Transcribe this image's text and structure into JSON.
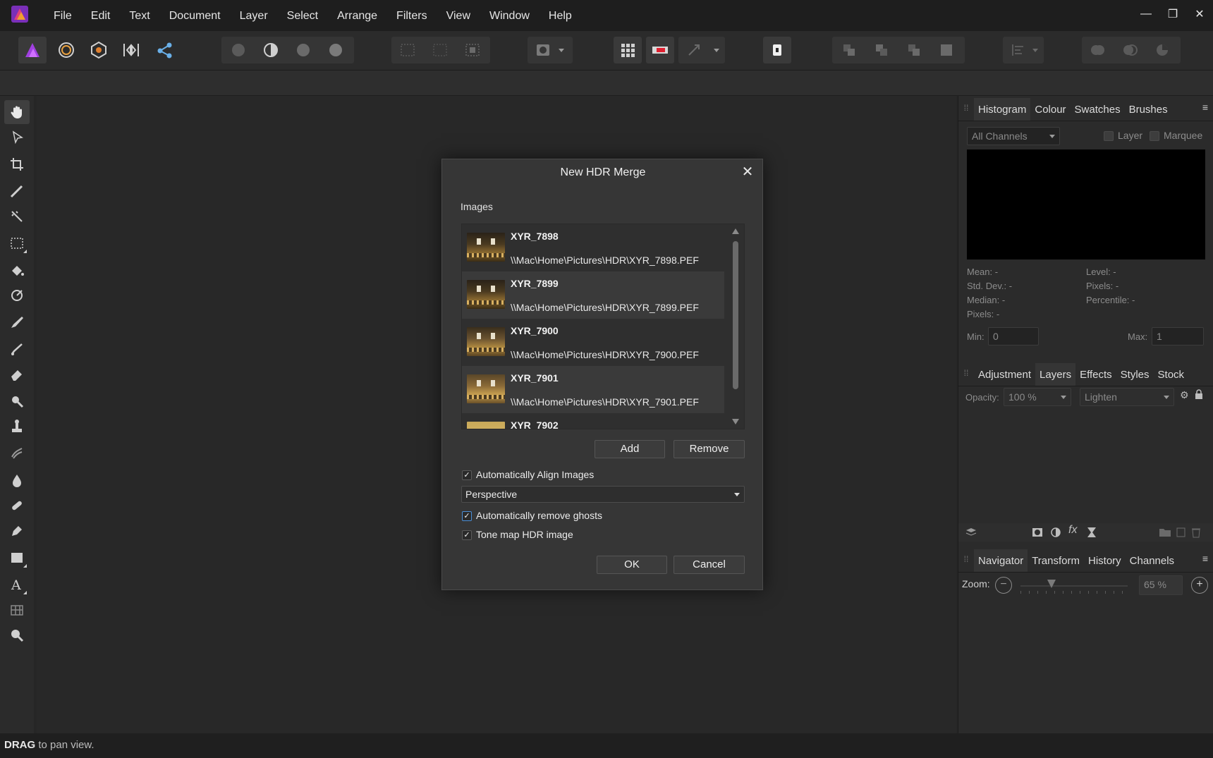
{
  "menu": [
    "File",
    "Edit",
    "Text",
    "Document",
    "Layer",
    "Select",
    "Arrange",
    "Filters",
    "View",
    "Window",
    "Help"
  ],
  "window_controls": {
    "minimize": "—",
    "restore": "❐",
    "close": "✕"
  },
  "status": {
    "bold": "DRAG",
    "rest": " to pan view."
  },
  "dialog": {
    "title": "New HDR Merge",
    "close": "✕",
    "images_label": "Images",
    "images": [
      {
        "name": "XYR_7898",
        "path": "\\\\Mac\\Home\\Pictures\\HDR\\XYR_7898.PEF"
      },
      {
        "name": "XYR_7899",
        "path": "\\\\Mac\\Home\\Pictures\\HDR\\XYR_7899.PEF"
      },
      {
        "name": "XYR_7900",
        "path": "\\\\Mac\\Home\\Pictures\\HDR\\XYR_7900.PEF"
      },
      {
        "name": "XYR_7901",
        "path": "\\\\Mac\\Home\\Pictures\\HDR\\XYR_7901.PEF"
      },
      {
        "name": "XYR_7902",
        "path": ""
      }
    ],
    "add_label": "Add",
    "remove_label": "Remove",
    "align_label": "Automatically Align Images",
    "align_checked": true,
    "align_mode": "Perspective",
    "ghosts_label": "Automatically remove ghosts",
    "ghosts_checked": true,
    "tonemap_label": "Tone map HDR image",
    "tonemap_checked": true,
    "ok_label": "OK",
    "cancel_label": "Cancel"
  },
  "histogram_panel": {
    "tabs": [
      "Histogram",
      "Colour",
      "Swatches",
      "Brushes"
    ],
    "channel": "All Channels",
    "layer_label": "Layer",
    "marquee_label": "Marquee",
    "stats_left": [
      "Mean: -",
      "Std. Dev.: -",
      "Median: -",
      "Pixels: -"
    ],
    "stats_right": [
      "Level: -",
      "Pixels: -",
      "Percentile: -"
    ],
    "min_label": "Min:",
    "min_value": "0",
    "max_label": "Max:",
    "max_value": "1"
  },
  "layers_panel": {
    "tabs": [
      "Adjustment",
      "Layers",
      "Effects",
      "Styles",
      "Stock"
    ],
    "opacity_label": "Opacity:",
    "opacity_value": "100 %",
    "blend_mode": "Lighten"
  },
  "navigator_panel": {
    "tabs": [
      "Navigator",
      "Transform",
      "History",
      "Channels"
    ],
    "zoom_label": "Zoom:",
    "zoom_value": "65 %"
  },
  "colors": {
    "accent": "#4a8fd8",
    "brand": "#9b3fd6"
  }
}
